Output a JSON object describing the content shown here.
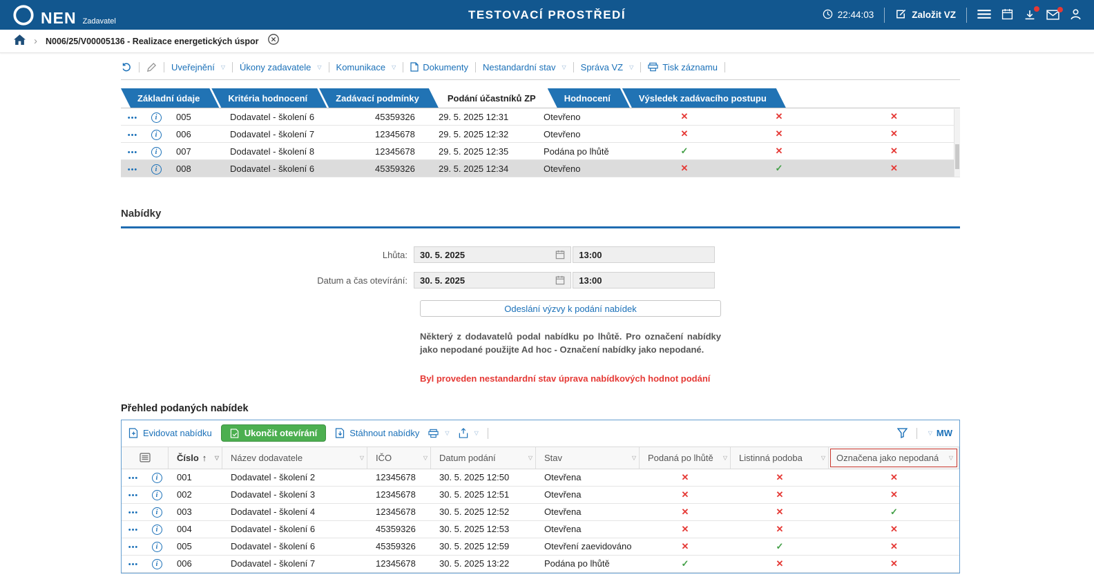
{
  "header": {
    "brand": "NEN",
    "brand_sub": "Zadavatel",
    "environment_title": "TESTOVACÍ PROSTŘEDÍ",
    "time": "22:44:03",
    "create_vz_label": "Založit VZ"
  },
  "breadcrumb": {
    "record": "N006/25/V00005136 - Realizace energetických úspor"
  },
  "record_toolbar": {
    "items": [
      {
        "label": "Uveřejnění",
        "dropdown": true
      },
      {
        "label": "Úkony zadavatele",
        "dropdown": true
      },
      {
        "label": "Komunikace",
        "dropdown": true
      },
      {
        "label": "Dokumenty",
        "icon": "document-icon"
      },
      {
        "label": "Nestandardní stav",
        "dropdown": true
      },
      {
        "label": "Správa VZ",
        "dropdown": true
      },
      {
        "label": "Tisk záznamu",
        "icon": "printer-icon"
      }
    ]
  },
  "tabs": [
    {
      "label": "Základní údaje"
    },
    {
      "label": "Kritéria hodnocení"
    },
    {
      "label": "Zadávací podmínky"
    },
    {
      "label": "Podání účastníků ZP",
      "active": true
    },
    {
      "label": "Hodnocení"
    },
    {
      "label": "Výsledek zadávacího postupu"
    }
  ],
  "participants_table": {
    "rows": [
      {
        "number": "005",
        "supplier": "Dodavatel - školení 6",
        "ico": "45359326",
        "submitted": "29. 5. 2025 12:31",
        "status": "Otevřeno",
        "late_mark": "✕",
        "paper_mark": "✕",
        "not_submitted_mark": "✕"
      },
      {
        "number": "006",
        "supplier": "Dodavatel - školení 7",
        "ico": "12345678",
        "submitted": "29. 5. 2025 12:32",
        "status": "Otevřeno",
        "late_mark": "✕",
        "paper_mark": "✕",
        "not_submitted_mark": "✕"
      },
      {
        "number": "007",
        "supplier": "Dodavatel - školení 8",
        "ico": "12345678",
        "submitted": "29. 5. 2025 12:35",
        "status": "Podána po lhůtě",
        "late_mark": "✓",
        "paper_mark": "✕",
        "not_submitted_mark": "✕"
      },
      {
        "number": "008",
        "supplier": "Dodavatel - školení 6",
        "ico": "45359326",
        "submitted": "29. 5. 2025 12:34",
        "status": "Otevřeno",
        "late_mark": "✕",
        "paper_mark": "✓",
        "not_submitted_mark": "✕",
        "selected": true
      }
    ]
  },
  "offers_section": {
    "title": "Nabídky",
    "deadline_label": "Lhůta:",
    "deadline_date": "30. 5. 2025",
    "deadline_time": "13:00",
    "opening_label": "Datum a čas otevírání:",
    "opening_date": "30. 5. 2025",
    "opening_time": "13:00",
    "send_invite_label": "Odeslání výzvy k podání nabídek",
    "late_note": "Některý z dodavatelů podal nabídku po lhůtě. Pro označení nabídky jako nepodané použijte Ad hoc - Označení nabídky jako nepodané.",
    "nonstandard_warning": "Byl proveden nestandardní stav úprava nabídkových hodnot podání"
  },
  "offers_table": {
    "title": "Přehled podaných nabídek",
    "toolbar": {
      "register_label": "Evidovat nabídku",
      "finish_opening_label": "Ukončit otevírání",
      "download_label": "Stáhnout nabídky",
      "user_initials": "MW"
    },
    "columns": {
      "number": "Číslo",
      "supplier": "Název dodavatele",
      "ico": "IČO",
      "submitted": "Datum podání",
      "status": "Stav",
      "late": "Podaná po lhůtě",
      "paper": "Listinná podoba",
      "not_submitted": "Označena jako nepodaná"
    },
    "rows": [
      {
        "number": "001",
        "supplier": "Dodavatel - školení 2",
        "ico": "12345678",
        "submitted": "30. 5. 2025 12:50",
        "status": "Otevřena",
        "late_mark": "✕",
        "paper_mark": "✕",
        "not_submitted_mark": "✕"
      },
      {
        "number": "002",
        "supplier": "Dodavatel - školení 3",
        "ico": "12345678",
        "submitted": "30. 5. 2025 12:51",
        "status": "Otevřena",
        "late_mark": "✕",
        "paper_mark": "✕",
        "not_submitted_mark": "✕"
      },
      {
        "number": "003",
        "supplier": "Dodavatel - školení 4",
        "ico": "12345678",
        "submitted": "30. 5. 2025 12:52",
        "status": "Otevřena",
        "late_mark": "✕",
        "paper_mark": "✕",
        "not_submitted_mark": "✓"
      },
      {
        "number": "004",
        "supplier": "Dodavatel - školení 6",
        "ico": "45359326",
        "submitted": "30. 5. 2025 12:53",
        "status": "Otevřena",
        "late_mark": "✕",
        "paper_mark": "✕",
        "not_submitted_mark": "✕"
      },
      {
        "number": "005",
        "supplier": "Dodavatel - školení 6",
        "ico": "45359326",
        "submitted": "30. 5. 2025 12:59",
        "status": "Otevření zaevidováno",
        "late_mark": "✕",
        "paper_mark": "✓",
        "not_submitted_mark": "✕"
      },
      {
        "number": "006",
        "supplier": "Dodavatel - školení 7",
        "ico": "12345678",
        "submitted": "30. 5. 2025 13:22",
        "status": "Podána po lhůtě",
        "late_mark": "✓",
        "paper_mark": "✕",
        "not_submitted_mark": "✕"
      }
    ]
  }
}
